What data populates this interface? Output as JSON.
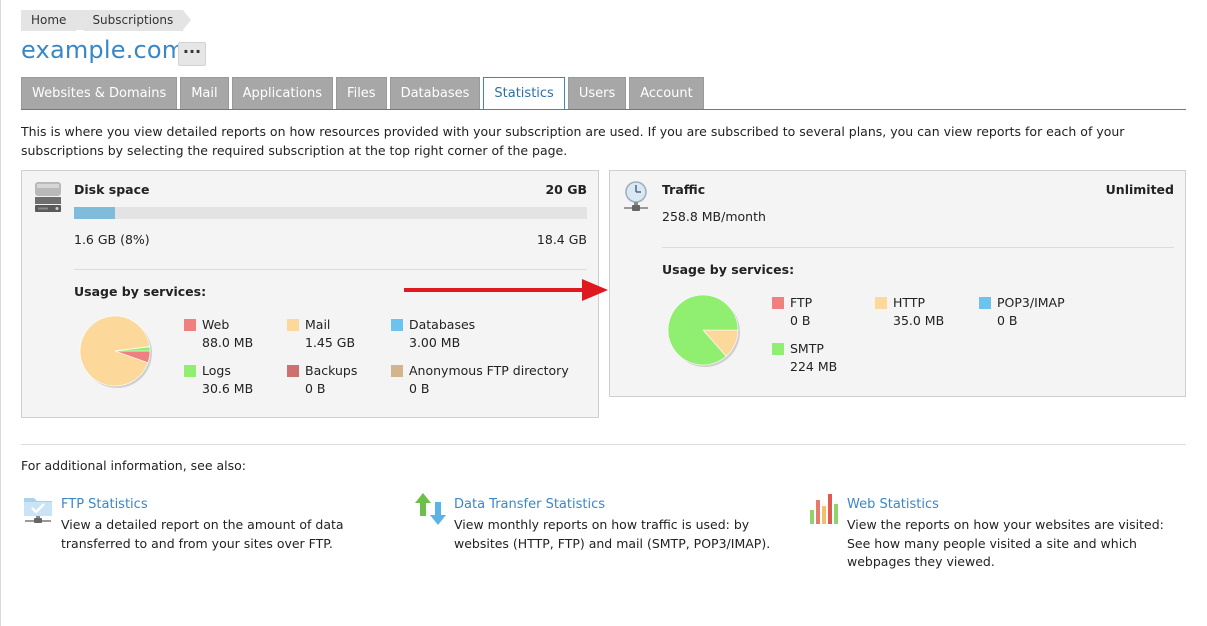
{
  "breadcrumb": {
    "home": "Home",
    "subscriptions": "Subscriptions"
  },
  "title": "example.com",
  "more_button": "···",
  "tabs": [
    "Websites & Domains",
    "Mail",
    "Applications",
    "Files",
    "Databases",
    "Statistics",
    "Users",
    "Account"
  ],
  "active_tab": "Statistics",
  "intro": "This is where you view detailed reports on how resources provided with your subscription are used. If you are subscribed to several plans, you can view reports for each of your subscriptions by selecting the required subscription at the top right corner of the page.",
  "disk": {
    "title": "Disk space",
    "total": "20 GB",
    "used": "1.6 GB (8%)",
    "free": "18.4 GB",
    "used_fraction": 0.08,
    "usage_heading": "Usage by services:",
    "services": [
      {
        "name": "Web",
        "value": "88.0 MB",
        "color": "#f08080"
      },
      {
        "name": "Mail",
        "value": "1.45 GB",
        "color": "#fcd99a"
      },
      {
        "name": "Databases",
        "value": "3.00 MB",
        "color": "#6cc4ee"
      },
      {
        "name": "Logs",
        "value": "30.6 MB",
        "color": "#90ee70"
      },
      {
        "name": "Backups",
        "value": "0 B",
        "color": "#cd7070"
      },
      {
        "name": "Anonymous FTP directory",
        "value": "0 B",
        "color": "#d4b48c"
      }
    ]
  },
  "traffic": {
    "title": "Traffic",
    "limit": "Unlimited",
    "rate": "258.8 MB/month",
    "usage_heading": "Usage by services:",
    "services": [
      {
        "name": "FTP",
        "value": "0 B",
        "color": "#f08080"
      },
      {
        "name": "HTTP",
        "value": "35.0 MB",
        "color": "#fcd99a"
      },
      {
        "name": "POP3/IMAP",
        "value": "0 B",
        "color": "#6cc4ee"
      },
      {
        "name": "SMTP",
        "value": "224 MB",
        "color": "#90ee70"
      }
    ]
  },
  "see_also": "For additional information, see also:",
  "links": [
    {
      "title": "FTP Statistics",
      "desc": "View a detailed report on the amount of data transferred to and from your sites over FTP.",
      "icon": "ftp-folder-icon"
    },
    {
      "title": "Data Transfer Statistics",
      "desc": "View monthly reports on how traffic is used: by websites (HTTP, FTP) and mail (SMTP, POP3/IMAP).",
      "icon": "data-transfer-arrows-icon"
    },
    {
      "title": "Web Statistics",
      "desc": "View the reports on how your websites are visited: See how many people visited a site and which webpages they viewed.",
      "icon": "bar-chart-icon"
    }
  ],
  "annotation_color": "#e0191e"
}
